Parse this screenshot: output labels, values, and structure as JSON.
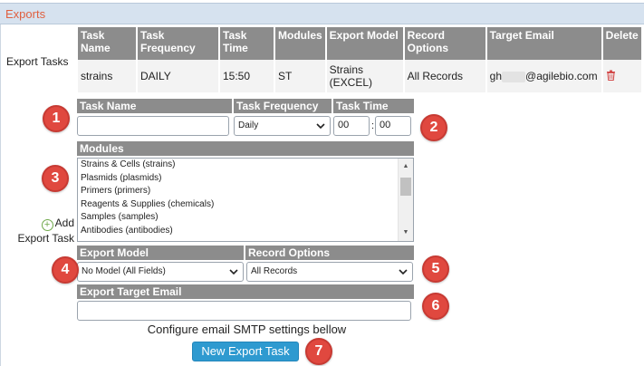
{
  "panel": {
    "title": "Exports"
  },
  "export_tasks_label": "Export Tasks",
  "tasks_table": {
    "headers": [
      "Task Name",
      "Task Frequency",
      "Task Time",
      "Modules",
      "Export Model",
      "Record Options",
      "Target Email",
      "Delete"
    ],
    "rows": [
      {
        "task_name": "strains",
        "frequency": "DAILY",
        "time": "15:50",
        "modules": "ST",
        "export_model": "Strains (EXCEL)",
        "record_options": "All Records",
        "email_prefix": "gh",
        "email_suffix": "@agilebio.com",
        "delete_icon": "trash-icon"
      }
    ]
  },
  "form": {
    "task_name": {
      "header": "Task Name",
      "value": ""
    },
    "task_frequency": {
      "header": "Task Frequency",
      "value": "Daily"
    },
    "task_time": {
      "header": "Task Time",
      "hour": "00",
      "minute": "00",
      "separator": ":"
    },
    "modules": {
      "header": "Modules",
      "items": [
        "Strains & Cells (strains)",
        "Plasmids (plasmids)",
        "Primers (primers)",
        "Reagents & Supplies (chemicals)",
        "Samples (samples)",
        "Antibodies (antibodies)"
      ]
    },
    "export_model": {
      "header": "Export Model",
      "value": "No Model (All Fields)"
    },
    "record_options": {
      "header": "Record Options",
      "value": "All Records"
    },
    "target_email": {
      "header": "Export Target Email",
      "value": ""
    }
  },
  "add_task": {
    "label_line1": "Add",
    "label_line2": "Export Task",
    "icon": "plus-circle-icon"
  },
  "smtp_note": "Configure email SMTP settings bellow",
  "submit_button": {
    "label": "New Export Task"
  },
  "badges": [
    "1",
    "2",
    "3",
    "4",
    "5",
    "6",
    "7"
  ],
  "colors": {
    "header_text": "#e06040",
    "header_bg": "#d6e2ef",
    "table_header_bg": "#8c8c8c",
    "badge": "#e0483f",
    "primary_button": "#2e9ad0",
    "add_icon": "#6fa84a",
    "delete_icon": "#d34b4b"
  }
}
